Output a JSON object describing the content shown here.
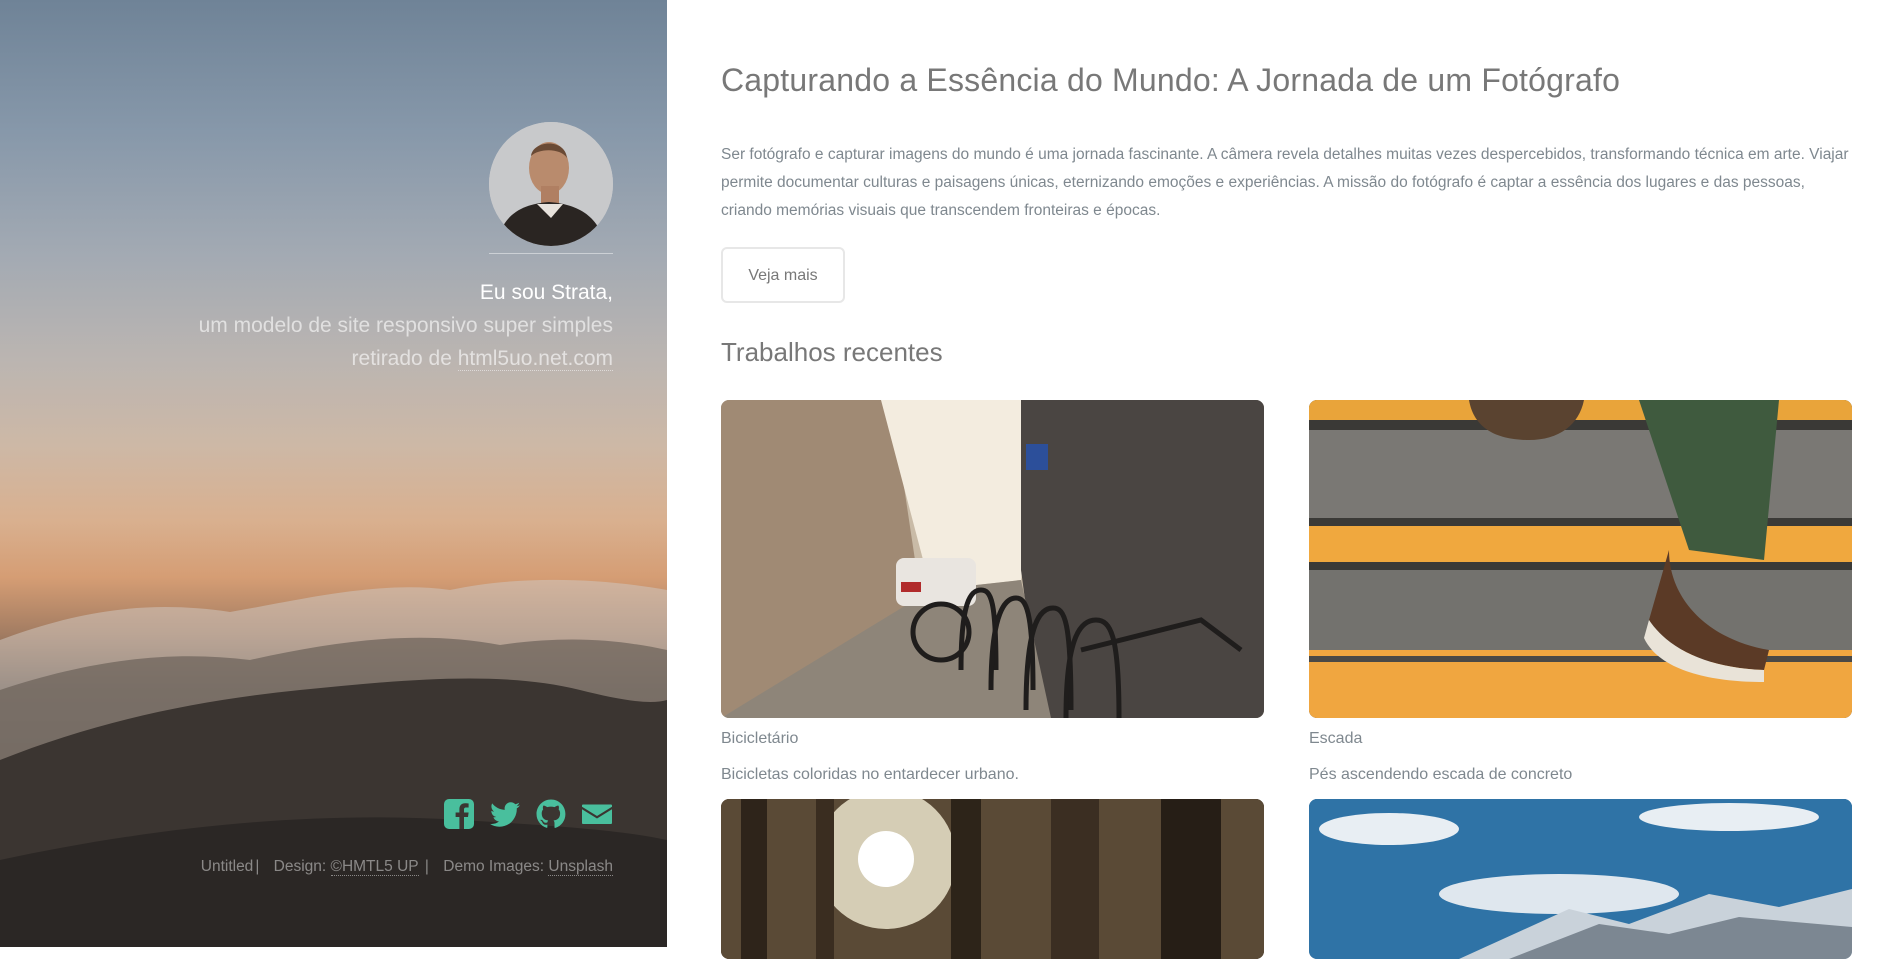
{
  "sidebar": {
    "greeting": "Eu sou Strata,",
    "tagline": "um modelo de site responsivo super simples",
    "source_prefix": "retirado de ",
    "source_link": "html5uo.net.com",
    "social": [
      {
        "icon": "facebook-icon",
        "label": "Facebook"
      },
      {
        "icon": "twitter-icon",
        "label": "Twitter"
      },
      {
        "icon": "github-icon",
        "label": "GitHub"
      },
      {
        "icon": "email-icon",
        "label": "Email"
      }
    ],
    "footer": {
      "untitled": "Untitled",
      "design_label": "Design: ",
      "design_link": "©HMTL5 UP",
      "images_label": "Demo Images: ",
      "images_link": "Unsplash"
    },
    "accent_color": "#49bf9d"
  },
  "main": {
    "title": "Capturando a Essência do Mundo: A Jornada de um Fotógrafo",
    "lead": "Ser fotógrafo e capturar imagens do mundo é uma jornada fascinante. A câmera revela detalhes muitas vezes despercebidos, transformando técnica em arte. Viajar permite documentar culturas e paisagens únicas, eternizando emoções e experiências. A missão do fotógrafo é captar a essência dos lugares e das pessoas, criando memórias visuais que transcendem fronteiras e épocas.",
    "button_label": "Veja mais",
    "recent_heading": "Trabalhos recentes",
    "works": [
      {
        "title": "Bicicletário",
        "description": "Bicicletas coloridas no entardecer urbano."
      },
      {
        "title": "Escada",
        "description": "Pés ascendendo escada de concreto"
      }
    ]
  }
}
